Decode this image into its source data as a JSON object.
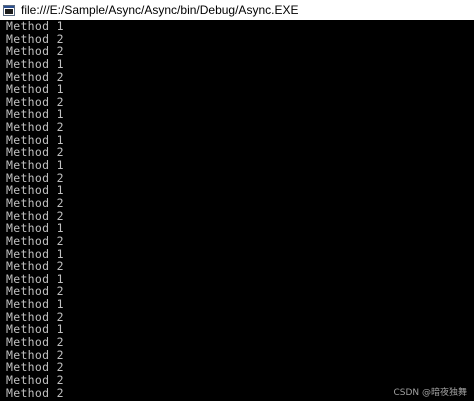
{
  "window": {
    "title": "file:///E:/Sample/Async/Async/bin/Debug/Async.EXE",
    "icon": "console-app-icon"
  },
  "console": {
    "lines": [
      "Method 1",
      "Method 2",
      "Method 2",
      "Method 1",
      "Method 2",
      "Method 1",
      "Method 2",
      "Method 1",
      "Method 2",
      "Method 1",
      "Method 2",
      "Method 1",
      "Method 2",
      "Method 1",
      "Method 2",
      "Method 2",
      "Method 1",
      "Method 2",
      "Method 1",
      "Method 2",
      "Method 1",
      "Method 2",
      "Method 1",
      "Method 2",
      "Method 1",
      "Method 2",
      "Method 2",
      "Method 2",
      "Method 2",
      "Method 2"
    ]
  },
  "watermark": "CSDN @暗夜独舞",
  "colors": {
    "console_background": "#000000",
    "console_text": "#c0c0c0",
    "titlebar_background": "#ffffff"
  }
}
